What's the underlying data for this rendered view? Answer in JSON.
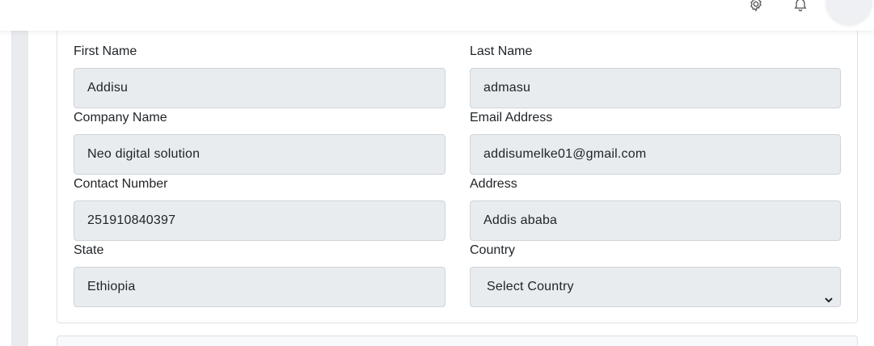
{
  "form": {
    "first_name": {
      "label": "First Name",
      "value": "Addisu"
    },
    "last_name": {
      "label": "Last Name",
      "value": "admasu"
    },
    "company_name": {
      "label": "Company Name",
      "value": "Neo digital solution"
    },
    "email_address": {
      "label": "Email Address",
      "value": "addisumelke01@gmail.com"
    },
    "contact_number": {
      "label": "Contact Number",
      "value": "251910840397"
    },
    "address": {
      "label": "Address",
      "value": "Addis ababa"
    },
    "state": {
      "label": "State",
      "value": "Ethiopia"
    },
    "country": {
      "label": "Country",
      "selected": "Select Country"
    }
  },
  "topbar": {
    "icons": [
      "gear-icon",
      "bell-icon"
    ]
  },
  "colors": {
    "input_bg": "#e9ecef",
    "border": "#ced4da",
    "text": "#212529"
  }
}
